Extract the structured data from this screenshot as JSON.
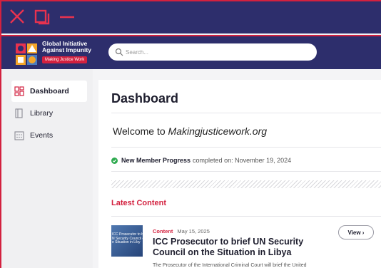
{
  "window": {
    "close_icon": "x-icon",
    "maximize_icon": "square-icon",
    "minimize_icon": "minus-icon",
    "accent_color": "#d3213f",
    "bar_color": "#2d2e6c"
  },
  "brand": {
    "line1": "Global Initiative",
    "line2": "Against Impunity",
    "tagline": "Making Justice Work"
  },
  "search": {
    "placeholder": "Search..."
  },
  "sidebar": {
    "items": [
      {
        "label": "Dashboard",
        "icon": "dashboard-icon",
        "active": true
      },
      {
        "label": "Library",
        "icon": "library-icon",
        "active": false
      },
      {
        "label": "Events",
        "icon": "calendar-icon",
        "active": false
      }
    ]
  },
  "main": {
    "title": "Dashboard",
    "welcome_prefix": "Welcome to ",
    "welcome_site": "Makingjusticework.org",
    "progress": {
      "label": "New Member Progress",
      "text": "completed on: November 19, 2024"
    },
    "latest_heading": "Latest Content",
    "card": {
      "tag": "Content",
      "date": "May 15, 2025",
      "title": "ICC Prosecutor to brief UN Security Council on the Situation in Libya",
      "thumb_line1": "ICC Prosecutor to bri",
      "thumb_line2": "N Security Council o",
      "thumb_line3": "e Situation in Liby",
      "view_label": "View ›",
      "description": "The Prosecutor of the International Criminal Court will brief the United"
    }
  }
}
